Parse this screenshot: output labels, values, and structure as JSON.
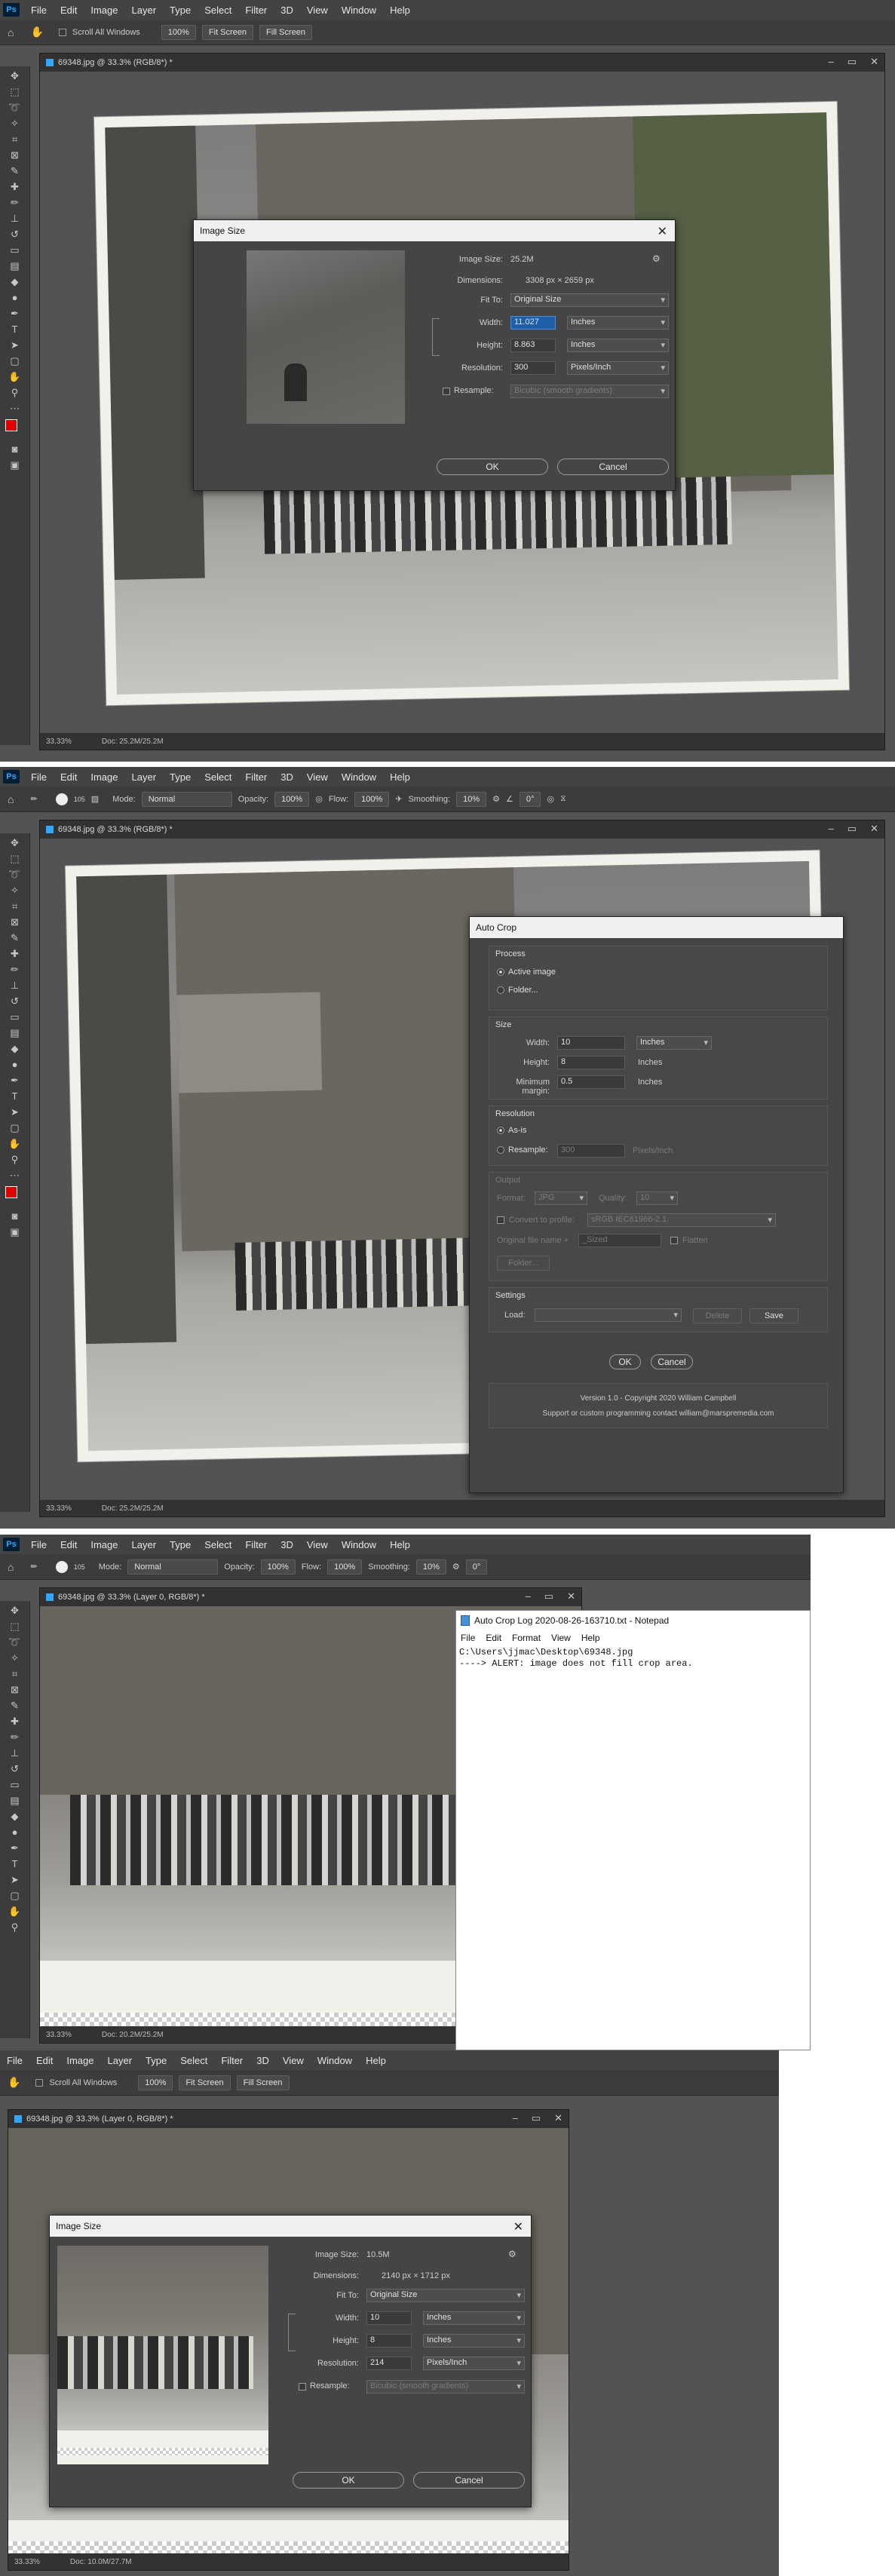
{
  "menu": [
    "File",
    "Edit",
    "Image",
    "Layer",
    "Type",
    "Select",
    "Filter",
    "3D",
    "View",
    "Window",
    "Help"
  ],
  "ps_logo": "Ps",
  "s1": {
    "options": {
      "scroll_all": "Scroll All Windows",
      "zoom": "100%",
      "fit": "Fit Screen",
      "fill": "Fill Screen"
    },
    "doc_title": "69348.jpg @ 33.3% (RGB/8*) *",
    "zoom": "33.33%",
    "doc_info": "Doc: 25.2M/25.2M",
    "dialog": {
      "title": "Image Size",
      "image_size_label": "Image Size:",
      "image_size": "25.2M",
      "dimensions_label": "Dimensions:",
      "dimensions": "3308 px  ×  2659 px",
      "fit_label": "Fit To:",
      "fit": "Original Size",
      "width_label": "Width:",
      "width": "11.027",
      "width_unit": "Inches",
      "height_label": "Height:",
      "height": "8.863",
      "height_unit": "Inches",
      "res_label": "Resolution:",
      "res": "300",
      "res_unit": "Pixels/Inch",
      "resample_label": "Resample:",
      "resample": "Bicubic (smooth gradients)",
      "ok": "OK",
      "cancel": "Cancel"
    }
  },
  "s2": {
    "options": {
      "mode_label": "Mode:",
      "mode": "Normal",
      "opacity_label": "Opacity:",
      "opacity": "100%",
      "flow_label": "Flow:",
      "flow": "100%",
      "smoothing_label": "Smoothing:",
      "smoothing": "10%",
      "angle": "0°",
      "brush": "105"
    },
    "doc_title": "69348.jpg @ 33.3% (RGB/8*) *",
    "zoom": "33.33%",
    "doc_info": "Doc: 25.2M/25.2M",
    "dialog": {
      "title": "Auto Crop",
      "process": "Process",
      "active_image": "Active image",
      "folder": "Folder...",
      "size": "Size",
      "width_label": "Width:",
      "width": "10",
      "width_unit": "Inches",
      "height_label": "Height:",
      "height": "8",
      "height_unit": "Inches",
      "margin_label": "Minimum margin:",
      "margin": "0.5",
      "margin_unit": "Inches",
      "resolution": "Resolution",
      "as_is": "As-is",
      "resample": "Resample:",
      "res_value": "300",
      "res_unit": "Pixels/Inch",
      "output": "Output",
      "format_label": "Format:",
      "format": "JPG",
      "quality_label": "Quality:",
      "quality": "10",
      "convert": "Convert to profile:",
      "profile": "sRGB IEC61966-2.1",
      "orig_name": "Original file name +",
      "suffix": "_Sized",
      "flatten": "Flatten",
      "folder_btn": "Folder...",
      "settings": "Settings",
      "load_label": "Load:",
      "delete": "Delete",
      "save": "Save",
      "ok": "OK",
      "cancel": "Cancel",
      "version": "Version 1.0 - Copyright 2020 William Campbell",
      "support": "Support or custom programming contact william@marspremedia.com"
    }
  },
  "s3": {
    "doc_title": "69348.jpg @ 33.3% (Layer 0, RGB/8*) *",
    "zoom": "33.33%",
    "doc_info": "Doc: 20.2M/25.2M",
    "notepad": {
      "title": "Auto Crop Log 2020-08-26-163710.txt - Notepad",
      "menu": [
        "File",
        "Edit",
        "Format",
        "View",
        "Help"
      ],
      "line1": "C:\\Users\\jjmac\\Desktop\\69348.jpg",
      "line2": "----> ALERT: image does not fill crop area."
    }
  },
  "s4": {
    "doc_title": "69348.jpg @ 33.3% (Layer 0, RGB/8*) *",
    "zoom": "33.33%",
    "doc_info": "Doc: 10.0M/27.7M",
    "dialog": {
      "title": "Image Size",
      "image_size_label": "Image Size:",
      "image_size": "10.5M",
      "dimensions_label": "Dimensions:",
      "dimensions": "2140 px  ×  1712 px",
      "fit_label": "Fit To:",
      "fit": "Original Size",
      "width_label": "Width:",
      "width": "10",
      "width_unit": "Inches",
      "height_label": "Height:",
      "height": "8",
      "height_unit": "Inches",
      "res_label": "Resolution:",
      "res": "214",
      "res_unit": "Pixels/Inch",
      "resample_label": "Resample:",
      "resample": "Bicubic (smooth gradients)",
      "ok": "OK",
      "cancel": "Cancel"
    }
  }
}
